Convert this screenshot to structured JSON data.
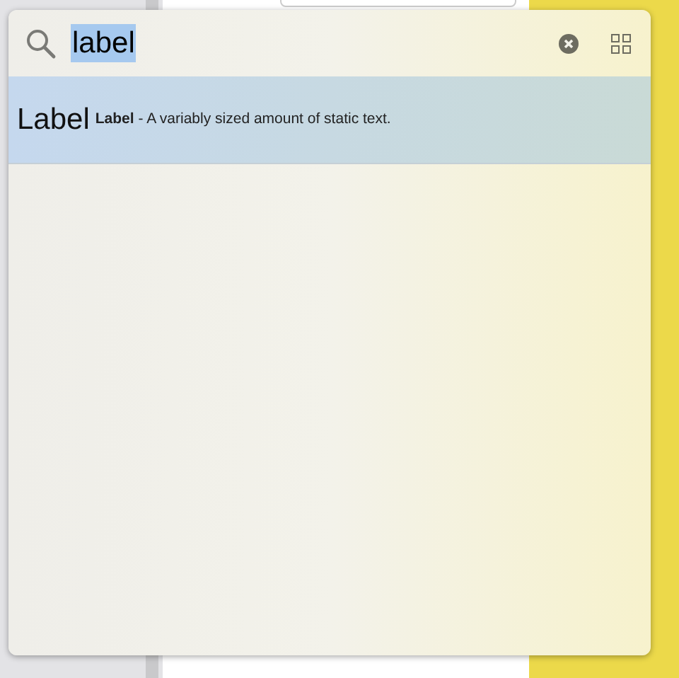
{
  "search": {
    "value": "label",
    "text_selected": true
  },
  "results": [
    {
      "title": "Label",
      "description": "**Label** - A variably sized amount of static text.",
      "selected": true
    }
  ]
}
